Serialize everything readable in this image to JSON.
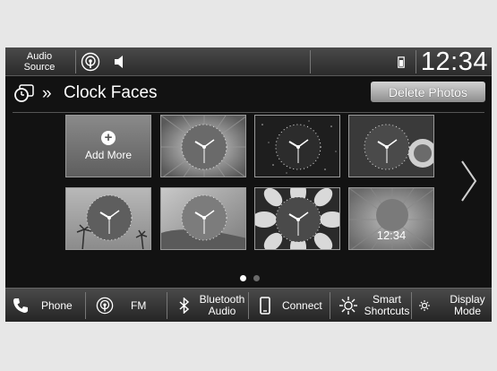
{
  "status_bar": {
    "audio_source_line1": "Audio",
    "audio_source_line2": "Source",
    "time": "12:34"
  },
  "header": {
    "chevrons": "»",
    "title": "Clock Faces",
    "delete_button": "Delete Photos"
  },
  "grid": {
    "add_more_label": "Add More",
    "tile_time": "12:34",
    "page_dots": {
      "total": 2,
      "active": 1
    }
  },
  "bottom_bar": {
    "phone": "Phone",
    "fm": "FM",
    "bluetooth_line1": "Bluetooth",
    "bluetooth_line2": "Audio",
    "connect": "Connect",
    "smart_line1": "Smart",
    "smart_line2": "Shortcuts",
    "display_line1": "Display",
    "display_line2": "Mode"
  },
  "colors": {
    "screen_bg": "#121212",
    "bar_gradient_top": "#4a4a4a",
    "button_gray": "#8d8d8d",
    "text": "#ffffff"
  }
}
